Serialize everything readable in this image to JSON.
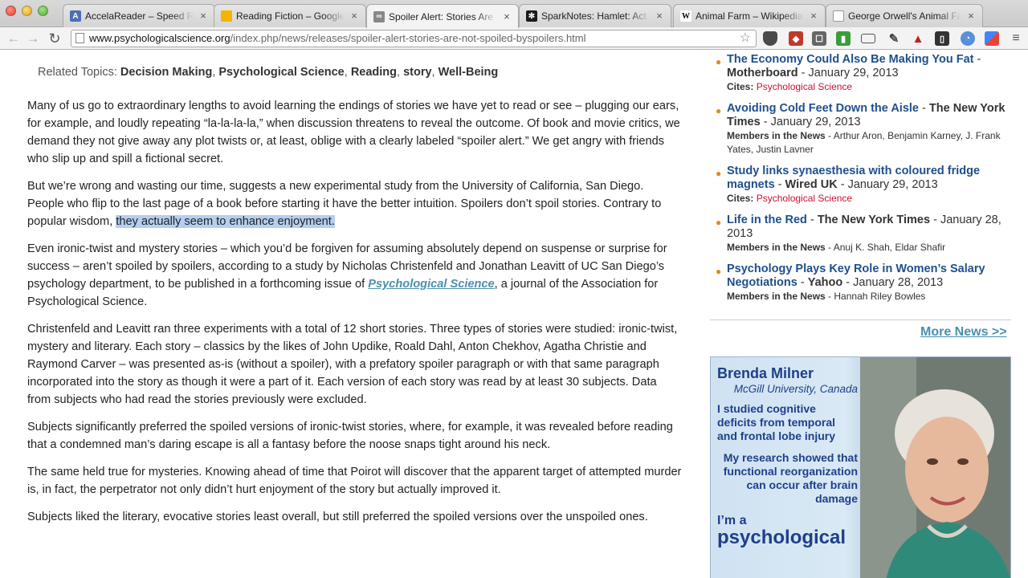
{
  "tabs": [
    {
      "label": "AccelaReader – Speed Rea",
      "favicon_color": "#4a6fb5",
      "favicon_glyph": "A"
    },
    {
      "label": "Reading Fiction – Google D",
      "favicon_color": "#f4b400",
      "favicon_glyph": ""
    },
    {
      "label": "Spoiler Alert: Stories Are N",
      "favicon_color": "#888888",
      "favicon_glyph": "∞",
      "active": true
    },
    {
      "label": "SparkNotes: Hamlet: Act I,",
      "favicon_color": "#1a1a1a",
      "favicon_glyph": "✻"
    },
    {
      "label": "Animal Farm – Wikipedia,",
      "favicon_color": "#ffffff",
      "favicon_glyph": "W"
    },
    {
      "label": "George Orwell's Animal Fa",
      "favicon_color": "#ffffff",
      "favicon_glyph": ""
    }
  ],
  "toolbar": {
    "url_host": "www.psychologicalscience.org",
    "url_path": "/index.php/news/releases/spoiler-alert-stories-are-not-spoiled-byspoilers.html"
  },
  "related": {
    "label": "Related Topics:",
    "topics": [
      "Decision Making",
      "Psychological Science",
      "Reading",
      "story",
      "Well-Being"
    ]
  },
  "article": {
    "p1": "Many of us go to extraordinary lengths to avoid learning the endings of stories we have yet to read or see – plugging our ears, for example, and loudly repeating “la-la-la-la,” when discussion threatens to reveal the outcome. Of book and movie critics, we demand they not give away any plot twists or, at least, oblige with a clearly labeled “spoiler alert.” We get angry with friends who slip up and spill a fictional secret.",
    "p2_plain": "But we’re wrong and wasting our time, suggests a new experimental study from the University of California, San Diego. People who flip to the last page of a book before starting it have the better intuition. Spoilers don’t spoil stories. Contrary to popular wisdom, ",
    "p2_highlight": "they actually seem to enhance enjoyment.",
    "p3_before": "Even ironic-twist and mystery stories – which you’d be forgiven for assuming absolutely depend on suspense or surprise for success – aren’t spoiled by spoilers, according to a study by Nicholas Christenfeld and Jonathan Leavitt of  UC San Diego’s psychology department, to be published in a forthcoming issue of ",
    "p3_link": "Psychological Science",
    "p3_after": ", a journal of the Association for Psychological Science.",
    "p4": "Christenfeld and Leavitt ran three experiments with a total of 12 short stories. Three types of stories were studied: ironic-twist, mystery and literary. Each story – classics by the likes of John Updike, Roald Dahl, Anton Chekhov, Agatha Christie and Raymond Carver – was presented as-is (without a spoiler), with a prefatory spoiler paragraph or with that same paragraph incorporated into the story as though it were a part of it. Each version of each story was read by at least 30 subjects. Data from subjects who had read the stories previously were excluded.",
    "p5": "Subjects significantly preferred the spoiled versions of ironic-twist stories, where, for example, it was revealed before reading that a condemned man’s daring escape is all a fantasy before the noose snaps tight around his neck.",
    "p6": "The same held true for mysteries. Knowing ahead of time that Poirot will discover that the apparent target of attempted murder is, in fact, the perpetrator not only didn’t hurt enjoyment of the story but actually improved it.",
    "p7": "Subjects liked the literary, evocative stories least overall, but still preferred the spoiled versions over the unspoiled ones."
  },
  "news": [
    {
      "title": "The Economy Could Also Be Making You Fat",
      "source": "Motherboard",
      "date": "January 29, 2013",
      "meta_label": "Cites:",
      "meta_value": "Psychological Science",
      "meta_kind": "cites"
    },
    {
      "title": "Avoiding Cold Feet Down the Aisle",
      "source": "The New York Times",
      "date": "January 29, 2013",
      "meta_label": "Members in the News",
      "meta_value": "Arthur Aron, Benjamin Karney, J. Frank Yates, Justin Lavner",
      "meta_kind": "members"
    },
    {
      "title": "Study links synaesthesia with coloured fridge magnets",
      "source": "Wired UK",
      "date": "January 29, 2013",
      "meta_label": "Cites:",
      "meta_value": "Psychological Science",
      "meta_kind": "cites"
    },
    {
      "title": "Life in the Red",
      "source": "The New York Times",
      "date": "January 28, 2013",
      "meta_label": "Members in the News",
      "meta_value": "Anuj K. Shah, Eldar Shafir",
      "meta_kind": "members"
    },
    {
      "title": "Psychology Plays Key Role in Women’s Salary Negotiations",
      "source": "Yahoo",
      "date": "January 28, 2013",
      "meta_label": "Members in the News",
      "meta_value": "Hannah Riley Bowles",
      "meta_kind": "members"
    }
  ],
  "more_news": "More News >>",
  "ad": {
    "name": "Brenda Milner",
    "affiliation": "McGill University, Canada",
    "quote1": "I studied cognitive deficits from temporal and frontal lobe injury",
    "quote2": "My research showed that functional reorganization can occur after brain damage",
    "im": "I’m a",
    "psych": "psychological"
  }
}
